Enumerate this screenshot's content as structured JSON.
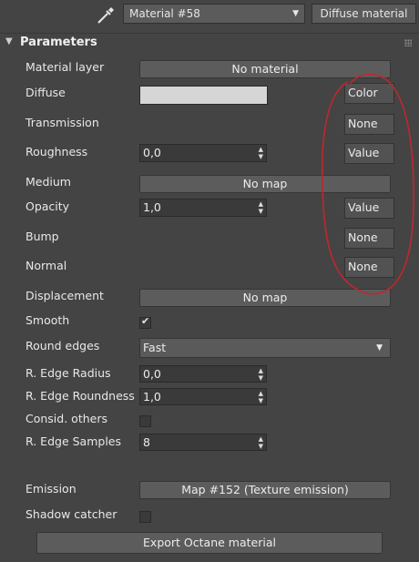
{
  "toolbar": {
    "material_name": "Material #58",
    "material_type": "Diffuse material"
  },
  "rollout": {
    "title": "Parameters"
  },
  "params": {
    "material_layer_label": "Material layer",
    "material_layer_button": "No material",
    "diffuse_label": "Diffuse",
    "diffuse_mode": "Color",
    "diffuse_color": "#d6d6d6",
    "transmission_label": "Transmission",
    "transmission_mode": "None",
    "roughness_label": "Roughness",
    "roughness_value": "0,0",
    "roughness_mode": "Value",
    "medium_label": "Medium",
    "medium_button": "No map",
    "opacity_label": "Opacity",
    "opacity_value": "1,0",
    "opacity_mode": "Value",
    "bump_label": "Bump",
    "bump_mode": "None",
    "normal_label": "Normal",
    "normal_mode": "None",
    "displacement_label": "Displacement",
    "displacement_button": "No map",
    "smooth_label": "Smooth",
    "smooth_checked": true,
    "round_edges_label": "Round edges",
    "round_edges_value": "Fast",
    "edge_radius_label": "R. Edge Radius",
    "edge_radius_value": "0,0",
    "edge_roundness_label": "R. Edge Roundness",
    "edge_roundness_value": "1,0",
    "consid_others_label": "Consid. others",
    "consid_others_checked": false,
    "edge_samples_label": "R. Edge Samples",
    "edge_samples_value": "8",
    "emission_label": "Emission",
    "emission_button": "Map #152 (Texture emission)",
    "shadow_catcher_label": "Shadow catcher",
    "shadow_catcher_checked": false,
    "export_button": "Export Octane material"
  },
  "colors": {
    "annotation": "#c0272d"
  },
  "icons": {
    "picker": "eyedropper-icon",
    "collapse": "collapse-triangle-icon"
  }
}
